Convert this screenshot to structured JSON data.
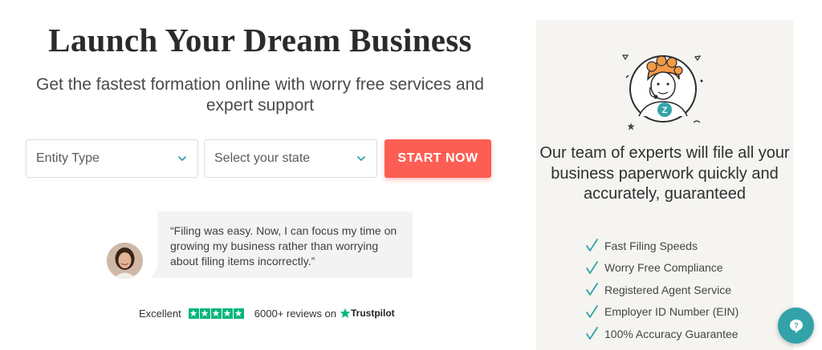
{
  "hero": {
    "title": "Launch Your Dream Business",
    "subtitle": "Get the fastest formation online with worry free services and expert support"
  },
  "form": {
    "entity_placeholder": "Entity Type",
    "state_placeholder": "Select your state",
    "cta_label": "START NOW"
  },
  "testimonial": {
    "quote": "“Filing was easy. Now, I can focus my time on growing my business rather than worrying about filing items incorrectly.”"
  },
  "trust": {
    "rating_label": "Excellent",
    "reviews": "6000+ reviews on",
    "brand": "Trustpilot",
    "stars": 5
  },
  "panel": {
    "title": "Our team of experts will file all your business paperwork quickly and accurately, guaranteed",
    "features": [
      "Fast Filing Speeds",
      "Worry Free Compliance",
      "Registered Agent Service",
      "Employer ID Number (EIN)",
      "100% Accuracy Guarantee"
    ]
  },
  "colors": {
    "accent": "#fd5e53",
    "teal": "#33a3a9",
    "trustpilot": "#00b67a",
    "panel_bg": "#f5f4f1"
  },
  "icons": {
    "chevron": "chevron-down-icon",
    "check": "check-icon",
    "chat": "chat-icon",
    "star": "star-icon"
  }
}
